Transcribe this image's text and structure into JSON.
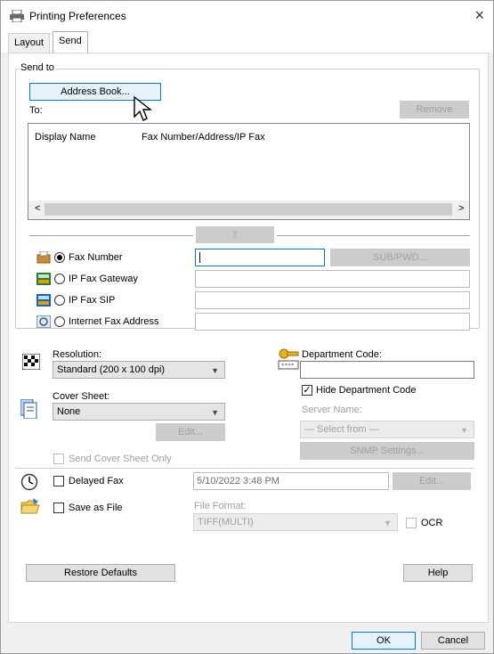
{
  "window": {
    "title": "Printing Preferences",
    "close_glyph": "×"
  },
  "tabs": [
    {
      "label": "Layout"
    },
    {
      "label": "Send"
    }
  ],
  "send_to": {
    "group_label": "Send to",
    "address_book_button": "Address Book...",
    "to_label": "To:",
    "remove_button": "Remove",
    "columns": [
      "Display Name",
      "Fax Number/Address/IP Fax"
    ],
    "scroll_left": "<",
    "scroll_right": ">",
    "add_arrow": "⇧"
  },
  "destinations": [
    {
      "label": "Fax Number",
      "selected": true
    },
    {
      "label": "IP Fax Gateway",
      "selected": false
    },
    {
      "label": "IP Fax SIP",
      "selected": false
    },
    {
      "label": "Internet Fax Address",
      "selected": false
    }
  ],
  "sub_pwd_button": "SUB/PWD...",
  "resolution": {
    "label": "Resolution:",
    "value": "Standard (200 x 100 dpi)"
  },
  "cover_sheet": {
    "label": "Cover Sheet:",
    "value": "None",
    "edit_button": "Edit..."
  },
  "department": {
    "label": "Department Code:",
    "hide_label": "Hide Department Code",
    "hide_checked": true,
    "server_name_label": "Server Name:",
    "server_value": "— Select from —",
    "snmp_button": "SNMP Settings..."
  },
  "send_cover_sheet_only": "Send Cover Sheet Only",
  "delayed_fax": {
    "label": "Delayed Fax",
    "datetime": "5/10/2022 3:48 PM",
    "edit_button": "Edit..."
  },
  "save_as_file": {
    "label": "Save as File",
    "file_format_label": "File Format:",
    "file_format_value": "TIFF(MULTI)",
    "ocr_label": "OCR"
  },
  "restore_defaults_button": "Restore Defaults",
  "help_button": "Help",
  "ok_button": "OK",
  "cancel_button": "Cancel"
}
